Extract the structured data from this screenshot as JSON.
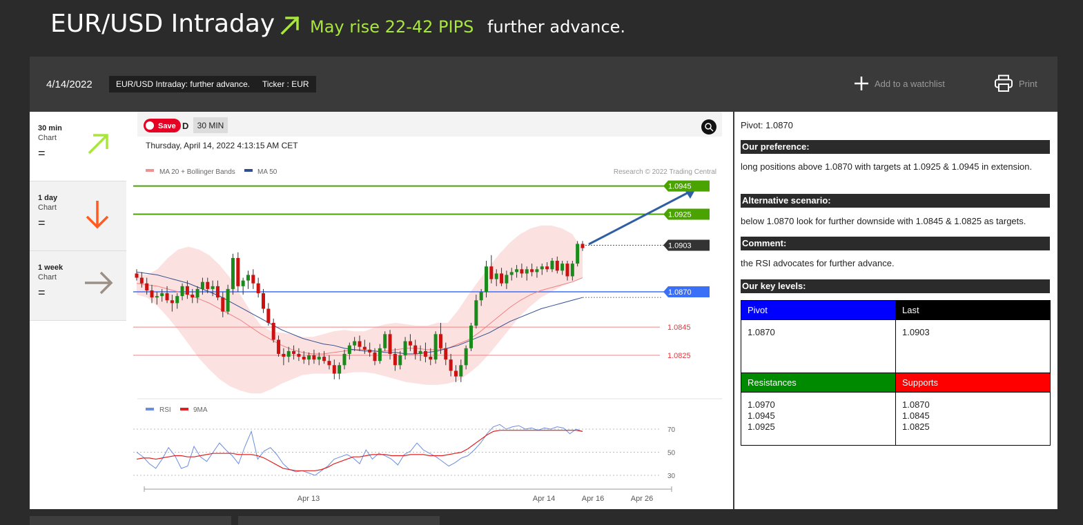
{
  "header": {
    "title": "EUR/USD Intraday",
    "rise_text": "May rise 22-42 PIPS",
    "advance_text": "further advance.",
    "accent_color": "#a8e63e"
  },
  "infobar": {
    "date": "4/14/2022",
    "tag_title": "EUR/USD Intraday: further advance.",
    "tag_ticker": "Ticker : EUR",
    "watchlist_label": "Add to a watchlist",
    "print_label": "Print"
  },
  "timeframes": [
    {
      "period": "30 min",
      "label": "Chart",
      "status": "=",
      "direction": "up",
      "icon": "arrow-up-right-icon",
      "color": "#a8e63e"
    },
    {
      "period": "1 day",
      "label": "Chart",
      "status": "=",
      "direction": "down",
      "icon": "arrow-down-icon",
      "color": "#ff5a1f"
    },
    {
      "period": "1 week",
      "label": "Chart",
      "status": "=",
      "direction": "right",
      "icon": "arrow-right-icon",
      "color": "#9b8f86"
    }
  ],
  "chart": {
    "save_label": "Save",
    "d_label": "D",
    "interval_label": "30 MIN",
    "datetime": "Thursday, April 14, 2022 4:13:15 AM CET",
    "legend_ma20": "MA 20 + Bollinger Bands",
    "legend_ma50": "MA 50",
    "copyright": "Research © 2022 Trading Central",
    "rsi_legend": "RSI",
    "rsi_ma_legend": "9MA"
  },
  "chart_data": {
    "type": "candlestick",
    "levels": [
      {
        "value": "1.0945",
        "role": "resistance",
        "color": "#4aa300"
      },
      {
        "value": "1.0925",
        "role": "resistance",
        "color": "#4aa300"
      },
      {
        "value": "1.0903",
        "role": "last",
        "color": "#333333"
      },
      {
        "value": "1.0870",
        "role": "pivot",
        "color": "#3a6ff7"
      },
      {
        "value": "1.0845",
        "role": "support",
        "color": "#e8333a"
      },
      {
        "value": "1.0825",
        "role": "support",
        "color": "#e8333a"
      }
    ],
    "x_ticks": [
      "Apr 13",
      "Apr 14",
      "Apr 16",
      "Apr 26"
    ],
    "rsi_ticks": [
      "70",
      "50",
      "30"
    ],
    "candles": [
      [
        1.0883,
        1.0886,
        1.0878,
        1.088
      ],
      [
        1.088,
        1.0884,
        1.0873,
        1.0876
      ],
      [
        1.0876,
        1.088,
        1.0868,
        1.0871
      ],
      [
        1.0871,
        1.0875,
        1.0862,
        1.0866
      ],
      [
        1.0866,
        1.087,
        1.0861,
        1.0867
      ],
      [
        1.0867,
        1.0872,
        1.0863,
        1.0869
      ],
      [
        1.0869,
        1.0874,
        1.0862,
        1.0864
      ],
      [
        1.0864,
        1.0868,
        1.0856,
        1.0862
      ],
      [
        1.0862,
        1.0869,
        1.0858,
        1.0867
      ],
      [
        1.0867,
        1.0876,
        1.0864,
        1.0874
      ],
      [
        1.0874,
        1.0878,
        1.0865,
        1.0868
      ],
      [
        1.0868,
        1.0872,
        1.0862,
        1.0866
      ],
      [
        1.0866,
        1.0874,
        1.0862,
        1.0872
      ],
      [
        1.0872,
        1.088,
        1.0868,
        1.0877
      ],
      [
        1.0877,
        1.088,
        1.0869,
        1.0872
      ],
      [
        1.0872,
        1.0878,
        1.0867,
        1.0874
      ],
      [
        1.0874,
        1.0878,
        1.0864,
        1.0866
      ],
      [
        1.0866,
        1.087,
        1.0852,
        1.0856
      ],
      [
        1.0856,
        1.0875,
        1.0854,
        1.0872
      ],
      [
        1.0872,
        1.0897,
        1.0868,
        1.0894
      ],
      [
        1.0894,
        1.0898,
        1.087,
        1.0874
      ],
      [
        1.0874,
        1.088,
        1.0868,
        1.0878
      ],
      [
        1.0878,
        1.0885,
        1.0872,
        1.0882
      ],
      [
        1.0882,
        1.0886,
        1.0872,
        1.0876
      ],
      [
        1.0876,
        1.088,
        1.0866,
        1.0869
      ],
      [
        1.0869,
        1.0872,
        1.0855,
        1.0858
      ],
      [
        1.0858,
        1.0862,
        1.0846,
        1.0848
      ],
      [
        1.0848,
        1.0851,
        1.0834,
        1.0836
      ],
      [
        1.0836,
        1.0839,
        1.0824,
        1.0826
      ],
      [
        1.0826,
        1.083,
        1.0818,
        1.0824
      ],
      [
        1.0824,
        1.0831,
        1.082,
        1.0828
      ],
      [
        1.0828,
        1.0832,
        1.0822,
        1.0826
      ],
      [
        1.0826,
        1.083,
        1.0821,
        1.0824
      ],
      [
        1.0824,
        1.0828,
        1.0819,
        1.0822
      ],
      [
        1.0822,
        1.0827,
        1.0818,
        1.0825
      ],
      [
        1.0825,
        1.0829,
        1.0819,
        1.0822
      ],
      [
        1.0822,
        1.0827,
        1.0818,
        1.0824
      ],
      [
        1.0824,
        1.0828,
        1.0819,
        1.0821
      ],
      [
        1.0821,
        1.0825,
        1.0815,
        1.0818
      ],
      [
        1.0818,
        1.0822,
        1.0808,
        1.0812
      ],
      [
        1.0812,
        1.082,
        1.0808,
        1.0818
      ],
      [
        1.0818,
        1.0829,
        1.0815,
        1.0826
      ],
      [
        1.0826,
        1.0834,
        1.0822,
        1.0832
      ],
      [
        1.0832,
        1.0838,
        1.0828,
        1.0835
      ],
      [
        1.0835,
        1.0839,
        1.0828,
        1.0831
      ],
      [
        1.0831,
        1.0836,
        1.0826,
        1.0829
      ],
      [
        1.0829,
        1.0834,
        1.0824,
        1.0827
      ],
      [
        1.0827,
        1.083,
        1.0818,
        1.0821
      ],
      [
        1.0821,
        1.0833,
        1.0819,
        1.083
      ],
      [
        1.083,
        1.0842,
        1.0828,
        1.084
      ],
      [
        1.084,
        1.0843,
        1.0822,
        1.0826
      ],
      [
        1.0826,
        1.083,
        1.0814,
        1.0818
      ],
      [
        1.0818,
        1.0828,
        1.0815,
        1.0825
      ],
      [
        1.0825,
        1.0838,
        1.0822,
        1.0835
      ],
      [
        1.0835,
        1.084,
        1.0828,
        1.0832
      ],
      [
        1.0832,
        1.0836,
        1.0822,
        1.0826
      ],
      [
        1.0826,
        1.0832,
        1.0821,
        1.0828
      ],
      [
        1.0828,
        1.0834,
        1.082,
        1.0824
      ],
      [
        1.0824,
        1.083,
        1.0818,
        1.0822
      ],
      [
        1.0822,
        1.0842,
        1.0819,
        1.084
      ],
      [
        1.084,
        1.0848,
        1.0826,
        1.083
      ],
      [
        1.083,
        1.0834,
        1.0818,
        1.0822
      ],
      [
        1.0822,
        1.0826,
        1.081,
        1.0814
      ],
      [
        1.0814,
        1.0818,
        1.0806,
        1.081
      ],
      [
        1.081,
        1.0822,
        1.0806,
        1.0818
      ],
      [
        1.0818,
        1.0832,
        1.0815,
        1.083
      ],
      [
        1.083,
        1.0848,
        1.0828,
        1.0846
      ],
      [
        1.0846,
        1.0868,
        1.0844,
        1.0864
      ],
      [
        1.0864,
        1.0872,
        1.086,
        1.087
      ],
      [
        1.087,
        1.0892,
        1.0866,
        1.0888
      ],
      [
        1.0888,
        1.0896,
        1.0876,
        1.0879
      ],
      [
        1.0879,
        1.0886,
        1.0874,
        1.0883
      ],
      [
        1.0883,
        1.0887,
        1.0874,
        1.0876
      ],
      [
        1.0876,
        1.0885,
        1.0872,
        1.0882
      ],
      [
        1.0882,
        1.0887,
        1.0878,
        1.0884
      ],
      [
        1.0884,
        1.0889,
        1.088,
        1.0886
      ],
      [
        1.0886,
        1.089,
        1.088,
        1.0883
      ],
      [
        1.0883,
        1.0888,
        1.0878,
        1.0886
      ],
      [
        1.0886,
        1.089,
        1.0881,
        1.0884
      ],
      [
        1.0884,
        1.0888,
        1.088,
        1.0886
      ],
      [
        1.0886,
        1.089,
        1.0882,
        1.0888
      ],
      [
        1.0888,
        1.0891,
        1.0884,
        1.0886
      ],
      [
        1.0886,
        1.0894,
        1.0884,
        1.0892
      ],
      [
        1.0892,
        1.0895,
        1.0883,
        1.0885
      ],
      [
        1.0885,
        1.0892,
        1.0882,
        1.089
      ],
      [
        1.089,
        1.0892,
        1.0878,
        1.0881
      ],
      [
        1.0881,
        1.0892,
        1.0878,
        1.089
      ],
      [
        1.089,
        1.0906,
        1.0888,
        1.0904
      ],
      [
        1.0904,
        1.0906,
        1.0899,
        1.0901
      ]
    ],
    "ma20": [
      1.0876,
      1.0875,
      1.0874,
      1.0872,
      1.087,
      1.0868,
      1.0865,
      1.0862,
      1.0858,
      1.0854,
      1.085,
      1.0845,
      1.084,
      1.0836,
      1.0832,
      1.0829,
      1.0827,
      1.0826,
      1.0826,
      1.0827,
      1.0828,
      1.0829,
      1.0829,
      1.0828,
      1.0828,
      1.0829,
      1.083,
      1.083,
      1.0829,
      1.0829,
      1.083,
      1.0833,
      1.0836,
      1.0841,
      1.0847,
      1.0853,
      1.0859,
      1.0864,
      1.0868,
      1.0871,
      1.0873,
      1.0875,
      1.0877,
      1.088
    ],
    "ma50": [
      1.0884,
      1.0883,
      1.0882,
      1.088,
      1.0878,
      1.0876,
      1.0873,
      1.087,
      1.0867,
      1.0863,
      1.0859,
      1.0855,
      1.0851,
      1.0847,
      1.0843,
      1.084,
      1.0837,
      1.0835,
      1.0833,
      1.0832,
      1.083,
      1.0829,
      1.0828,
      1.0828,
      1.0827,
      1.0827,
      1.0826,
      1.0826,
      1.0827,
      1.0828,
      1.083,
      1.0832,
      1.0835,
      1.0838,
      1.0841,
      1.0845,
      1.0849,
      1.0852,
      1.0855,
      1.0858,
      1.086,
      1.0862,
      1.0864,
      1.0866
    ],
    "bb_upper": [
      1.0883,
      1.0882,
      1.0886,
      1.0894,
      1.09,
      1.0902,
      1.09,
      1.0896,
      1.0889,
      1.088,
      1.0868,
      1.0856,
      1.0846,
      1.0842,
      1.0841,
      1.084,
      1.0838,
      1.0838,
      1.084,
      1.0842,
      1.0843,
      1.0842,
      1.0842,
      1.0845,
      1.0847,
      1.0848,
      1.0847,
      1.0846,
      1.0846,
      1.0848,
      1.0848,
      1.0857,
      1.0868,
      1.0878,
      1.0888,
      1.0897,
      1.0905,
      1.0911,
      1.0915,
      1.0917,
      1.0917,
      1.0915,
      1.0911,
      1.09
    ],
    "bb_lower": [
      1.0868,
      1.0866,
      1.086,
      1.0852,
      1.0843,
      1.0833,
      1.0823,
      1.0815,
      1.0808,
      1.0803,
      1.08,
      1.0798,
      1.0798,
      1.0801,
      1.0805,
      1.0808,
      1.0811,
      1.0812,
      1.0812,
      1.0812,
      1.0812,
      1.0813,
      1.0813,
      1.0812,
      1.081,
      1.0808,
      1.0806,
      1.0805,
      1.0804,
      1.0804,
      1.0805,
      1.0807,
      1.0812,
      1.0818,
      1.0826,
      1.0835,
      1.0844,
      1.0853,
      1.086,
      1.0866,
      1.087,
      1.0874,
      1.0877,
      1.088
    ],
    "rsi": [
      50,
      46,
      40,
      36,
      44,
      54,
      47,
      36,
      38,
      55,
      46,
      42,
      50,
      58,
      52,
      47,
      40,
      55,
      68,
      44,
      51,
      54,
      48,
      40,
      35,
      33,
      34,
      32,
      30,
      34,
      38,
      44,
      46,
      48,
      45,
      40,
      52,
      44,
      49,
      47,
      44,
      39,
      48,
      51,
      58,
      52,
      49,
      46,
      42,
      38,
      41,
      45,
      47,
      52,
      58,
      66,
      72,
      74,
      70,
      72,
      73,
      70,
      71,
      69,
      71,
      70,
      72,
      71,
      66,
      70,
      68
    ],
    "rsi_ma": [
      44,
      45,
      45,
      44,
      45,
      46,
      47,
      47,
      46,
      46,
      47,
      48,
      49,
      49,
      49,
      49,
      48,
      48,
      48,
      47,
      45,
      42,
      39,
      36,
      35,
      34,
      34,
      34,
      34,
      35,
      37,
      40,
      42,
      44,
      46,
      46,
      47,
      48,
      48,
      48,
      47,
      47,
      47,
      48,
      48,
      48,
      47,
      47,
      47,
      48,
      49,
      50,
      53,
      57,
      61,
      65,
      68,
      69,
      69,
      69,
      69,
      69,
      69,
      69,
      69,
      69,
      69,
      69,
      69,
      69,
      68
    ]
  },
  "side": {
    "pivot_line": "Pivot: 1.0870",
    "preference_title": "Our preference:",
    "preference_text": "long positions above 1.0870 with targets at 1.0925 & 1.0945 in extension.",
    "alternative_title": "Alternative scenario:",
    "alternative_text": "below 1.0870 look for further downside with 1.0845 & 1.0825 as targets.",
    "comment_title": "Comment:",
    "comment_text": "the RSI advocates for further advance.",
    "key_levels_title": "Our key levels:",
    "key_levels": {
      "pivot_label": "Pivot",
      "pivot_value": "1.0870",
      "last_label": "Last",
      "last_value": "1.0903",
      "resistances_label": "Resistances",
      "resistances": [
        "1.0970",
        "1.0945",
        "1.0925"
      ],
      "supports_label": "Supports",
      "supports": [
        "1.0870",
        "1.0845",
        "1.0825"
      ],
      "colors": {
        "pivot": "#0000ff",
        "last": "#000000",
        "resistances": "#008a00",
        "supports": "#ff0000"
      }
    }
  }
}
